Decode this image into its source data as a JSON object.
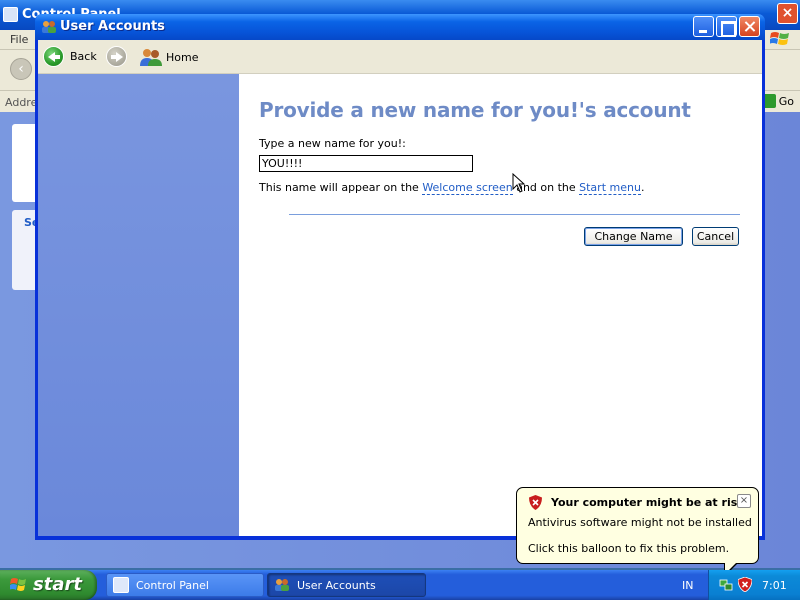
{
  "background_window": {
    "title": "Control Panel",
    "menu_first": "File",
    "address_label": "Address",
    "go_label": "Go",
    "panel_heading": "Se"
  },
  "window": {
    "title": "User Accounts",
    "toolbar": {
      "back_label": "Back",
      "home_label": "Home"
    }
  },
  "form": {
    "heading": "Provide a new name for you!'s account",
    "field_label": "Type a new name for you!:",
    "field_value": "YOU!!!!",
    "info_prefix": "This name will appear on the ",
    "link_welcome": "Welcome screen",
    "info_middle": " and on the ",
    "link_start_menu": "Start menu",
    "info_suffix": ".",
    "primary_button": "Change Name",
    "cancel_button": "Cancel"
  },
  "taskbar": {
    "start_label": "start",
    "tasks": [
      {
        "label": "Control Panel"
      },
      {
        "label": "User Accounts"
      }
    ],
    "language": "IN",
    "clock": "7:01"
  },
  "balloon": {
    "title": "Your computer might be at risk",
    "line1": "Antivirus software might not be installed",
    "line2": "Click this balloon to fix this problem.",
    "close_symbol": "×"
  },
  "icons": {
    "window": "users-icon",
    "back": "back-arrow-icon",
    "forward": "forward-arrow-icon",
    "home": "users-home-icon",
    "shield": "security-shield-icon"
  },
  "colors": {
    "heading": "#6e8bc6",
    "link": "#215dc6",
    "titlebar": "#0754d8",
    "taskbar": "#245edb",
    "start_button": "#3c9a3c",
    "balloon": "#ffffe1"
  }
}
